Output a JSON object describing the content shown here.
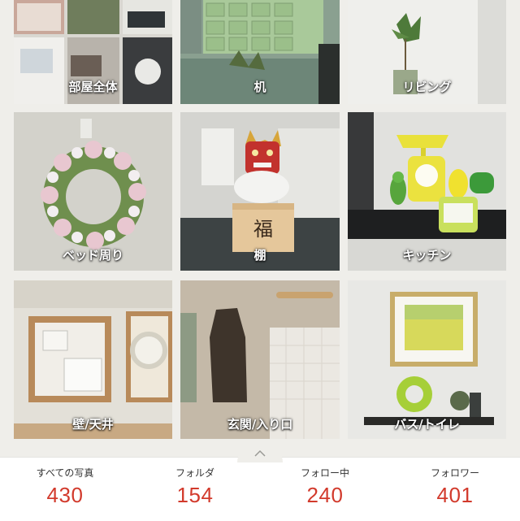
{
  "folders": [
    {
      "label": "部屋全体"
    },
    {
      "label": "机"
    },
    {
      "label": "リビング"
    },
    {
      "label": "ベッド周り"
    },
    {
      "label": "棚"
    },
    {
      "label": "キッチン"
    },
    {
      "label": "壁/天井"
    },
    {
      "label": "玄関/入り口"
    },
    {
      "label": "バス/トイレ"
    }
  ],
  "handle_icon": "chevron-up-icon",
  "stats": [
    {
      "label": "すべての写真",
      "value": "430"
    },
    {
      "label": "フォルダ",
      "value": "154"
    },
    {
      "label": "フォロー中",
      "value": "240"
    },
    {
      "label": "フォロワー",
      "value": "401"
    }
  ],
  "colors": {
    "accent": "#d23a2c",
    "background": "#efeeea"
  }
}
